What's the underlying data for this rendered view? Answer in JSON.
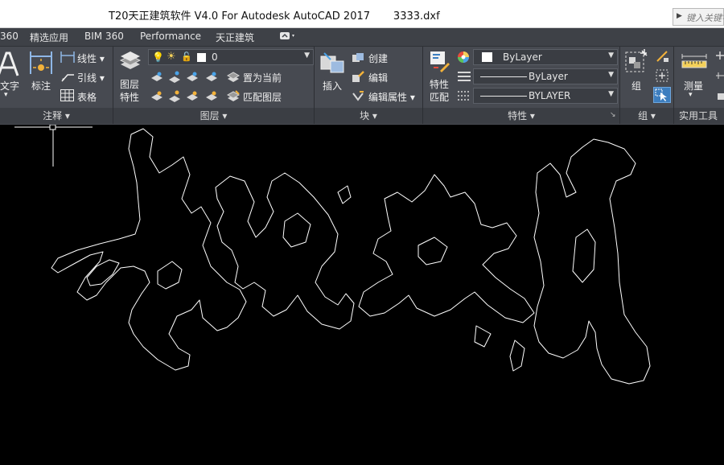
{
  "window": {
    "title": "T20天正建筑软件 V4.0 For Autodesk AutoCAD 2017       3333.dxf",
    "search_placeholder": "键入关键字"
  },
  "menu": {
    "items": [
      "360",
      "精选应用",
      "BIM 360",
      "Performance",
      "天正建筑"
    ]
  },
  "annotation_panel": {
    "title": "注释 ▾",
    "text_label": "文字",
    "dim_label": "标注",
    "linear_label": "线性 ▾",
    "leader_label": "引线 ▾",
    "table_label": "表格"
  },
  "layers_panel": {
    "title": "图层 ▾",
    "layer_props_label": "图层\n特性",
    "current_layer": "0",
    "set_current_label": "置为当前",
    "match_layer_label": "匹配图层"
  },
  "block_panel": {
    "title": "块 ▾",
    "insert_label": "插入",
    "create_label": "创建",
    "edit_label": "编辑",
    "edit_attr_label": "编辑属性 ▾"
  },
  "properties_panel": {
    "title": "特性 ▾",
    "match_label": "特性\n匹配",
    "color_value": "ByLayer",
    "linetype_value": "ByLayer",
    "lineweight_value": "BYLAYER"
  },
  "group_panel": {
    "title": "组 ▾",
    "group_label": "组"
  },
  "utilities_panel": {
    "title": "实用工具 ▾",
    "measure_label": "测量"
  },
  "colors": {
    "menubar": "#3e4147",
    "ribbon": "#474a51",
    "panel_title": "#3b3e44",
    "canvas": "#000000",
    "drawing_stroke": "#ffffff",
    "accent_blue": "#3d7ebf"
  }
}
